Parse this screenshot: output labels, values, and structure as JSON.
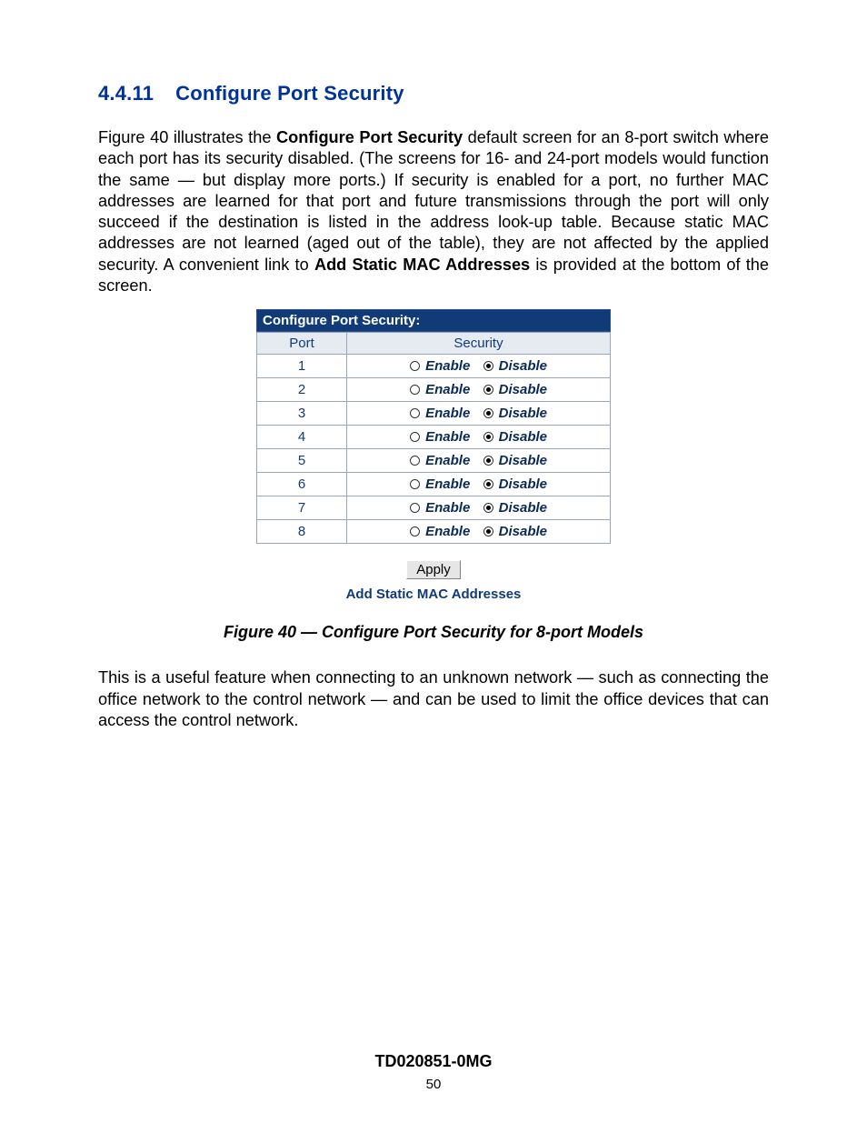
{
  "heading": {
    "number": "4.4.11",
    "title": "Configure Port Security"
  },
  "para1": {
    "a": "Figure 40 illustrates the ",
    "b_bold": "Configure Port Security",
    "c": " default screen for an 8-port switch where each port has its security disabled.  (The screens for 16- and 24-port models would function the same — but display more ports.)  If security is enabled for a port, no further MAC addresses are learned for that port and future transmissions through the port will only succeed if the destination is listed in the address look-up table.  Because static MAC addresses are not learned (aged out of the table), they are not affected by the applied security.  A convenient link to ",
    "d_bold": "Add Static MAC Addresses",
    "e": " is provided at the bottom of the screen."
  },
  "panel": {
    "title": "Configure Port Security:",
    "headers": {
      "port": "Port",
      "security": "Security"
    },
    "option_enable": "Enable",
    "option_disable": "Disable",
    "rows": [
      {
        "port": "1",
        "selected": "disable"
      },
      {
        "port": "2",
        "selected": "disable"
      },
      {
        "port": "3",
        "selected": "disable"
      },
      {
        "port": "4",
        "selected": "disable"
      },
      {
        "port": "5",
        "selected": "disable"
      },
      {
        "port": "6",
        "selected": "disable"
      },
      {
        "port": "7",
        "selected": "disable"
      },
      {
        "port": "8",
        "selected": "disable"
      }
    ],
    "apply_label": "Apply",
    "link_label": "Add Static MAC Addresses"
  },
  "caption": "Figure 40 — Configure Port Security for 8-port Models",
  "para2": "This is a useful feature when connecting to an unknown network — such as connecting the office network to the control network — and can be used to limit the office devices that can access the control network.",
  "footer": {
    "docid": "TD020851-0MG",
    "page": "50"
  }
}
